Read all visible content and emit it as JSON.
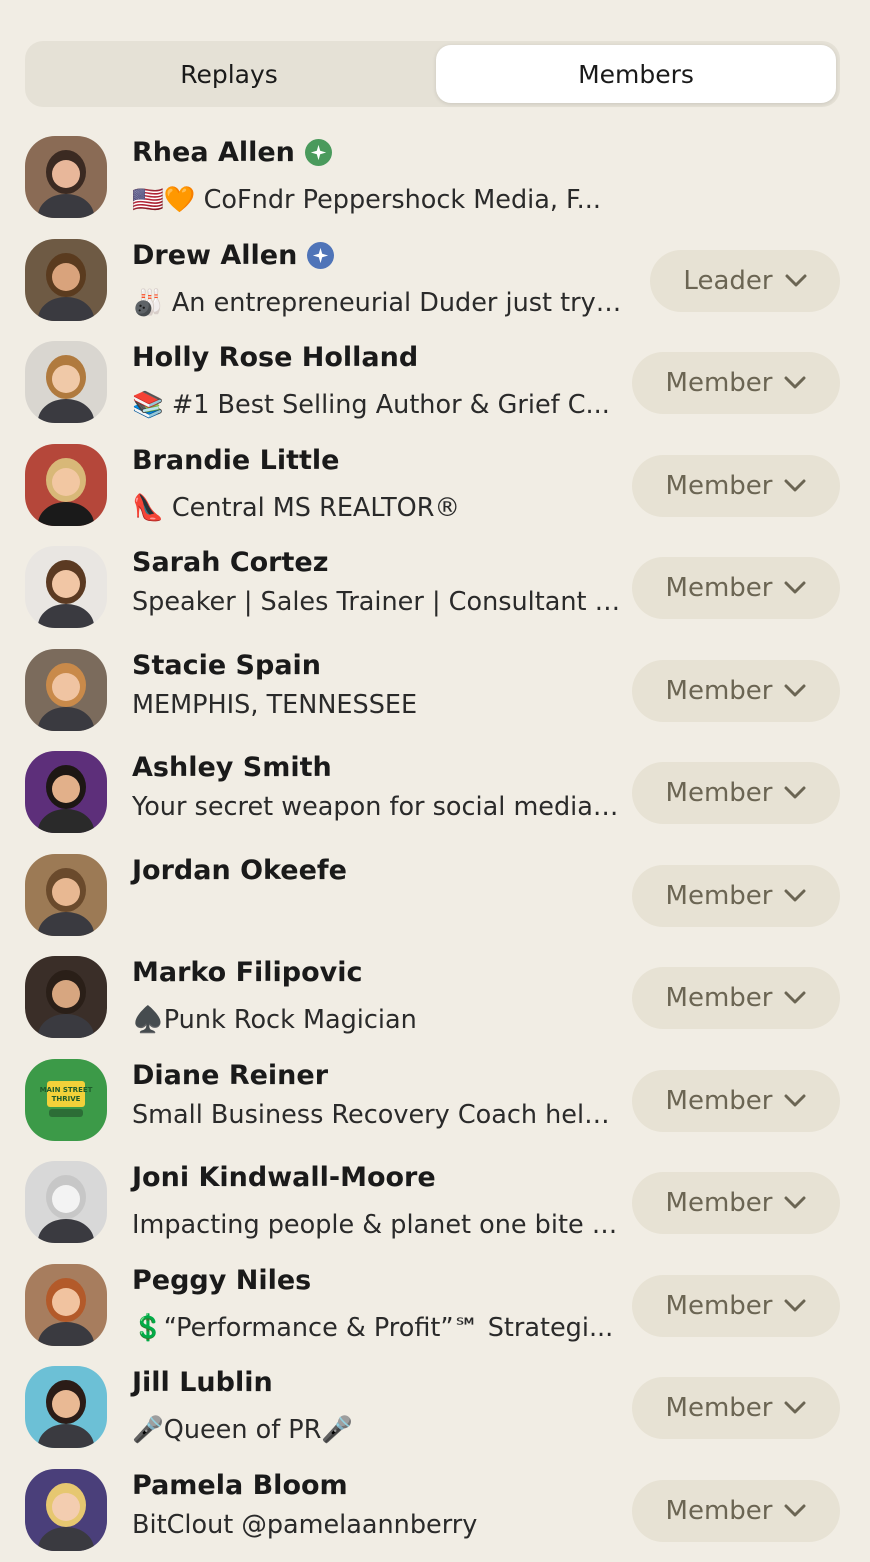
{
  "tabs": [
    {
      "label": "Replays",
      "active": false
    },
    {
      "label": "Members",
      "active": true
    }
  ],
  "colors": {
    "background": "#f1ede4",
    "role_button_bg": "#e7e2d4",
    "role_button_text": "#6b6553",
    "badge_green": "#4a9a5c",
    "badge_blue": "#4f74b8"
  },
  "members": [
    {
      "name": "Rhea Allen",
      "badge": "green-star-badge",
      "bio": "🇺🇸🧡 CoFndr Peppershock Media, F...",
      "role": ""
    },
    {
      "name": "Drew Allen",
      "badge": "blue-star-badge",
      "bio": "🎳 An entrepreneurial Duder just tryin...",
      "role": "Leader"
    },
    {
      "name": "Holly Rose Holland",
      "badge": "",
      "bio": "📚 #1 Best Selling Author & Grief C...",
      "role": "Member"
    },
    {
      "name": "Brandie Little",
      "badge": "",
      "bio": "👠 Central MS REALTOR®",
      "role": "Member"
    },
    {
      "name": "Sarah Cortez",
      "badge": "",
      "bio": "Speaker | Sales Trainer | Consultant |...",
      "role": "Member"
    },
    {
      "name": "Stacie Spain",
      "badge": "",
      "bio": "MEMPHIS, TENNESSEE",
      "role": "Member"
    },
    {
      "name": "Ashley Smith",
      "badge": "",
      "bio": "Your secret weapon for social media,...",
      "role": "Member"
    },
    {
      "name": "Jordan Okeefe",
      "badge": "",
      "bio": "",
      "role": "Member"
    },
    {
      "name": "Marko Filipovic",
      "badge": "",
      "bio": "♠️Punk Rock Magician",
      "role": "Member"
    },
    {
      "name": "Diane Reiner",
      "badge": "",
      "bio": "Small Business Recovery Coach help...",
      "role": "Member"
    },
    {
      "name": "Joni Kindwall-Moore",
      "badge": "",
      "bio": "Impacting people & planet one bite a...",
      "role": "Member"
    },
    {
      "name": "Peggy Niles",
      "badge": "",
      "bio": "💲“Performance & Profit”℠ Strategi...",
      "role": "Member"
    },
    {
      "name": "Jill Lublin",
      "badge": "",
      "bio": "🎤Queen of PR🎤",
      "role": "Member"
    },
    {
      "name": "Pamela Bloom",
      "badge": "",
      "bio": "BitClout @pamelaannberry",
      "role": "Member"
    }
  ],
  "avatar_logo": {
    "line1": "MAIN STREET",
    "line2": "THRIVE"
  }
}
